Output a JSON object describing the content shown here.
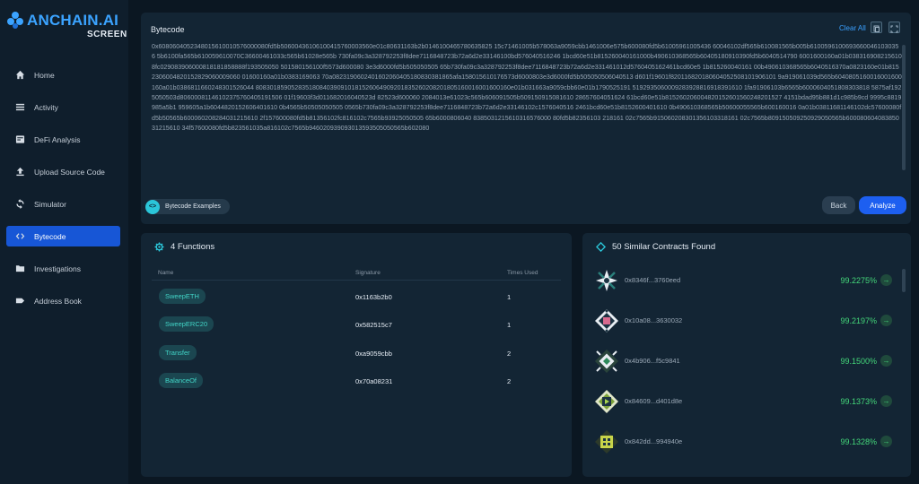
{
  "brand": {
    "name": "ANCHAIN.AI",
    "sub": "SCREEN",
    "color": "#3ba3ff"
  },
  "nav": [
    {
      "label": "Home",
      "icon": "home-icon"
    },
    {
      "label": "Activity",
      "icon": "list-icon"
    },
    {
      "label": "DeFi Analysis",
      "icon": "defi-icon"
    },
    {
      "label": "Upload Source Code",
      "icon": "upload-icon"
    },
    {
      "label": "Simulator",
      "icon": "refresh-icon"
    },
    {
      "label": "Bytecode",
      "icon": "code-icon",
      "active": true
    },
    {
      "label": "Investigations",
      "icon": "folder-icon"
    },
    {
      "label": "Address Book",
      "icon": "tag-icon"
    }
  ],
  "bytecode": {
    "title": "Bytecode",
    "clear_all": "Clear All",
    "text": "0x6080604052348015610010576000080fd5b50600436106100415760003560e01c80631163b2b0146100465780635825 15c71461005b578063a9059cbb1461006e575b600080fd5b61005961005436 60046102df565b610081565b005b61005961006936600461030356 5b6100fa565b610059610070C36600461033c565b61028e565b 730fa09c3a328792253f8dee7116848723b72a6d2e33146100bd576040516246 1bcd60e51b815260040161000b490610368565b60405180910390fd5b6040514790 6001600160a01b0383169082156108fc029083906000818181858888f193505050 501580156100f5573d600080 3e3d6000fd5b505050505 65b730fa09c3a328792253f8dee7116848723b72a6d2e331461012d5760405162461bcd60e5 1b815260040161 00b490610368565b6040516370a0823160e01b8152306004820152829060009060 01600160a01b0383169063 70a0823190602401602060405180830381865afa158015610176573d6000803e3d6000fd5b505050506040513 d601f19601f820116820180604052508101906101 9a919061039d565b6040805160016001600160a01b0386811660248301526044 808301859052835180840390910181526064909201835260208201805160016001600160e01b031663a9059cbb60e01b1790525191 5192935060009283928816918391610 1fa91906103b6565b6000604051808303818 5875af1925050503d80600081146102375760405191506 01f19603f3d011682016040523d 82523d600060 2084013e61023c565b606091505b509150915081610 28657604051624 61bcd60e51b815260206004820152601560248201527 4151bdad95b881d1c985b9cd 9995c8819985a5b1 959605a1b6044820152606401610 0b4565b50505050505 0565b730fa09c3a328792253f8dee7116848723b72a6d2e33146102c1576040516 2461bcd60e51b8152600401610 0b490610368565b50600055565b600160016 0a01b03811681146102dc57600080fd5b50565b600060208284031215610 2f157600080fd5b81356102fc816102c7565b93925050505 65b6000806040 8385031215610316576000 80fd5b82356103 218161 02c7565b915060208301356103318161 02c7565b809150509250929050565b60008060408385031215610 34f57600080fd5b823561035a816102c7565b946020939093013593505050565b602080",
    "examples_label": "Bytecode Examples",
    "back_label": "Back",
    "analyze_label": "Analyze"
  },
  "functions": {
    "title": "4 Functions",
    "headers": {
      "name": "Name",
      "signature": "Signature",
      "times": "Times Used"
    },
    "rows": [
      {
        "name": "SweepETH",
        "signature": "0x1163b2b0",
        "times": "1"
      },
      {
        "name": "SweepERC20",
        "signature": "0x582515c7",
        "times": "1"
      },
      {
        "name": "Transfer",
        "signature": "0xa9059cbb",
        "times": "2"
      },
      {
        "name": "BalanceOf",
        "signature": "0x70a08231",
        "times": "2"
      }
    ]
  },
  "similar": {
    "title": "50 Similar Contracts Found",
    "rows": [
      {
        "address": "0x8346f...3760eed",
        "score": "99.2275%"
      },
      {
        "address": "0x10a08...3630032",
        "score": "99.2197%"
      },
      {
        "address": "0x4b906...f5c9841",
        "score": "99.1500%"
      },
      {
        "address": "0x84609...d401d8e",
        "score": "99.1373%"
      },
      {
        "address": "0x842dd...994940e",
        "score": "99.1328%"
      }
    ]
  }
}
